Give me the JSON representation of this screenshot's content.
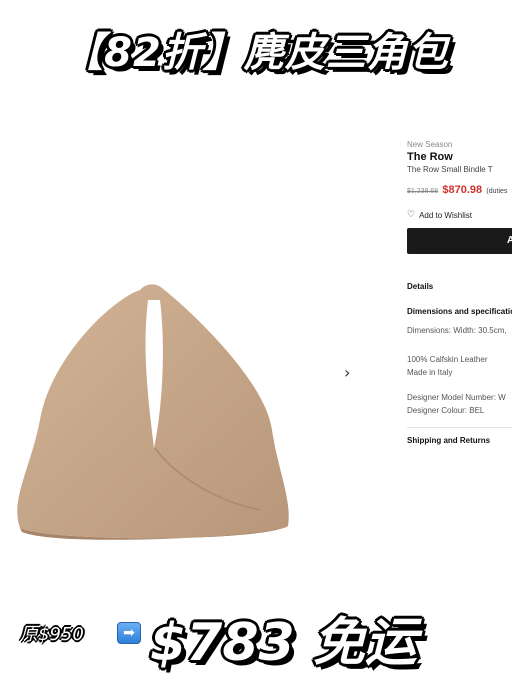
{
  "banner": {
    "title": "【82折】麂皮三角包"
  },
  "product": {
    "season": "New Season",
    "brand": "The Row",
    "name": "The Row Small Bindle T",
    "old_price": "$1,238.68",
    "price": "$870.98",
    "duties": "(duties",
    "wishlist": "Add to Wishlist",
    "add_button": "A"
  },
  "details": {
    "title": "Details",
    "dims_title": "Dimensions and specificatio",
    "dims_text": "Dimensions: Width: 30.5cm,",
    "material": "100% Calfskin Leather",
    "origin": "Made in Italy",
    "model_number": "Designer Model Number: W",
    "colour": "Designer Colour: BEL",
    "shipping": "Shipping and Returns"
  },
  "promo": {
    "original_price": "原$950",
    "arrow": "➡",
    "final_price": "$783 免运"
  },
  "icons": {
    "next": "chevron-right-icon",
    "heart": "heart-icon",
    "arrow": "right-arrow-icon"
  },
  "colors": {
    "bag": "#c8a88a",
    "price_red": "#d0342c",
    "button": "#1a1a1a"
  }
}
